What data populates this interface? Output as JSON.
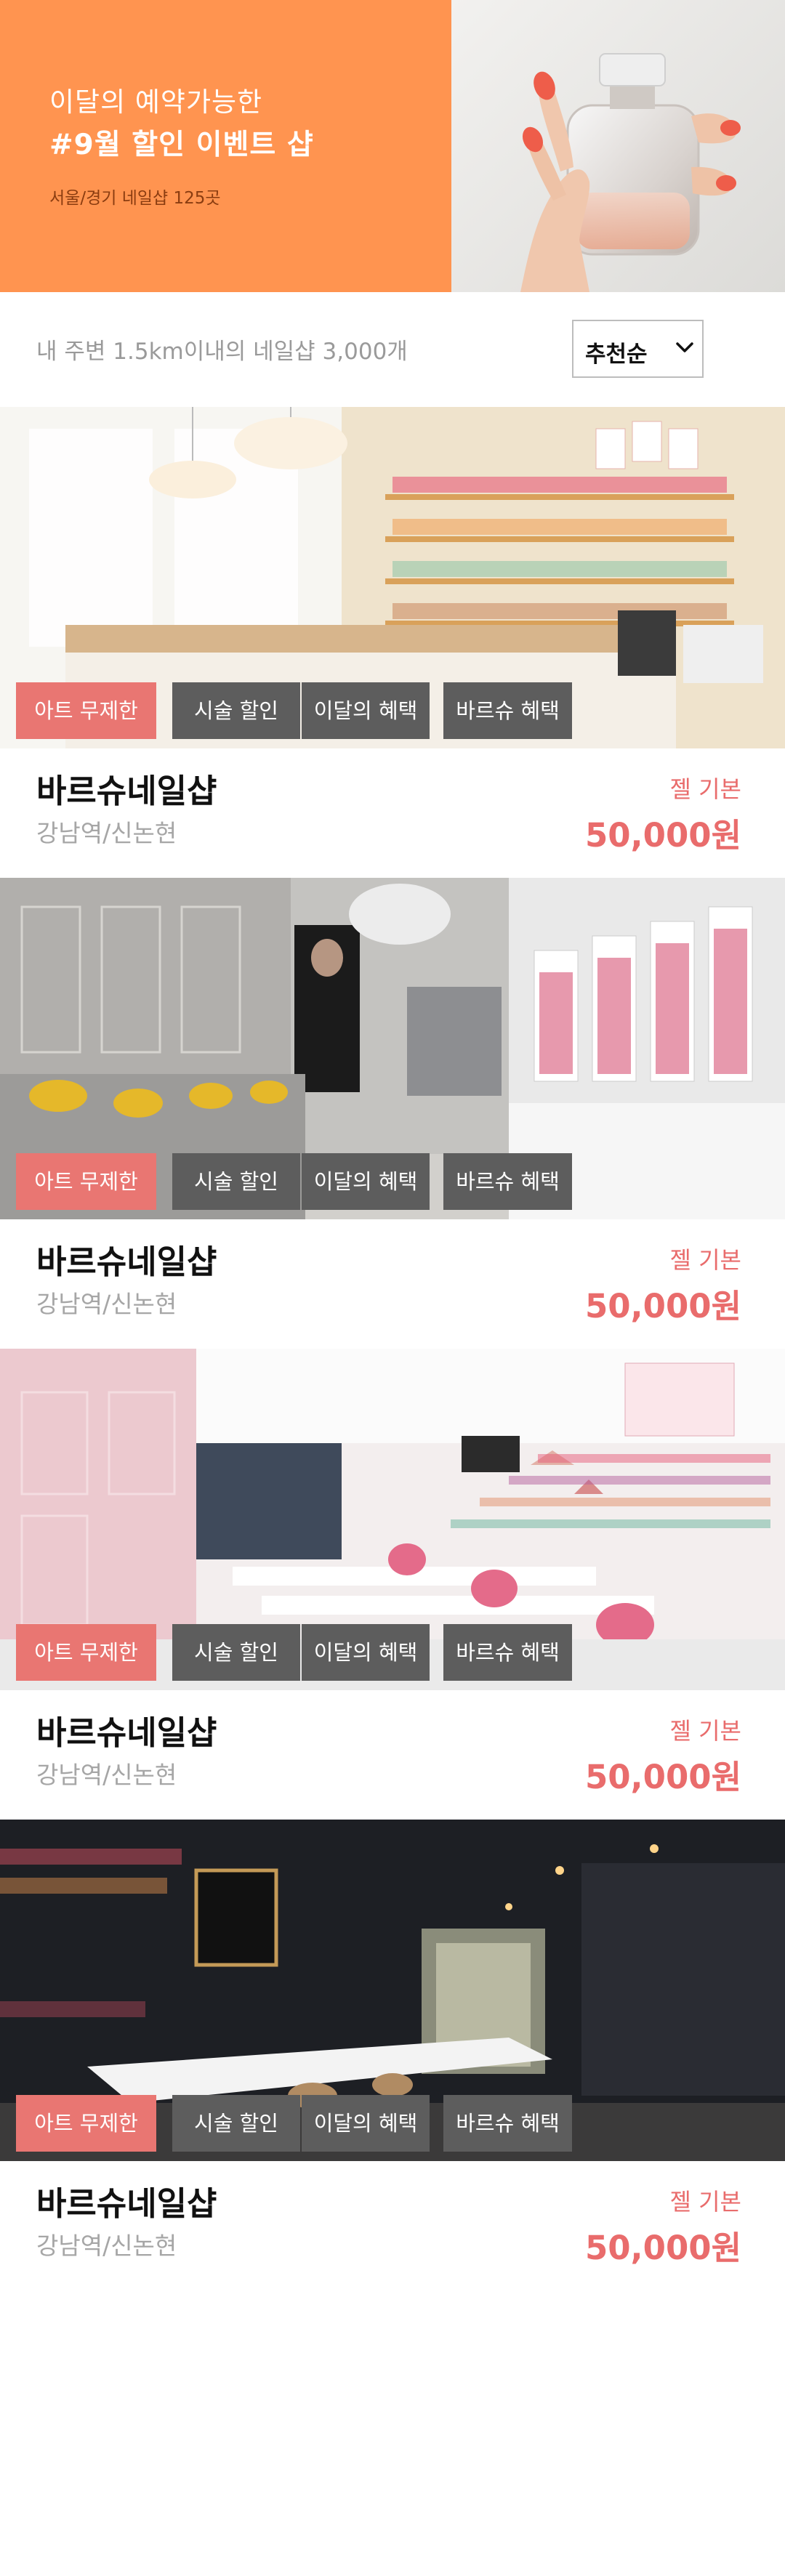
{
  "hero": {
    "subtitle": "이달의 예약가능한",
    "title": "#9월 할인 이벤트 샵",
    "caption": "서울/경기 네일샵 125곳",
    "background_color": "#ff9450",
    "image_icon": "perfume-bottle-hand-photo"
  },
  "sort_bar": {
    "info": "내 주변 1.5km이내의 네일샵 3,000개",
    "select_label": "추천순",
    "select_icon": "chevron-down-icon"
  },
  "shops": [
    {
      "photo": "bright-nail-salon-photo",
      "tags": [
        "아트 무제한",
        "시술 할인",
        "이달의 혜택",
        "바르슈 혜택"
      ],
      "name": "바르슈네일샵",
      "area": "강남역/신논현",
      "price_label": "젤 기본",
      "price": "50,000원"
    },
    {
      "photo": "grey-pedicure-salon-photo",
      "tags": [
        "아트 무제한",
        "시술 할인",
        "이달의 혜택",
        "바르슈 혜택"
      ],
      "name": "바르슈네일샵",
      "area": "강남역/신논현",
      "price_label": "젤 기본",
      "price": "50,000원"
    },
    {
      "photo": "pink-nail-salon-photo",
      "tags": [
        "아트 무제한",
        "시술 할인",
        "이달의 혜택",
        "바르슈 혜택"
      ],
      "name": "바르슈네일샵",
      "area": "강남역/신논현",
      "price_label": "젤 기본",
      "price": "50,000원"
    },
    {
      "photo": "dark-nail-salon-photo",
      "tags": [
        "아트 무제한",
        "시술 할인",
        "이달의 혜택",
        "바르슈 혜택"
      ],
      "name": "바르슈네일샵",
      "area": "강남역/신논현",
      "price_label": "젤 기본",
      "price": "50,000원"
    }
  ],
  "colors": {
    "accent": "#ff9450",
    "tag_primary": "#e97672",
    "tag_secondary": "#5d5d5d",
    "price": "#e96c6c"
  }
}
